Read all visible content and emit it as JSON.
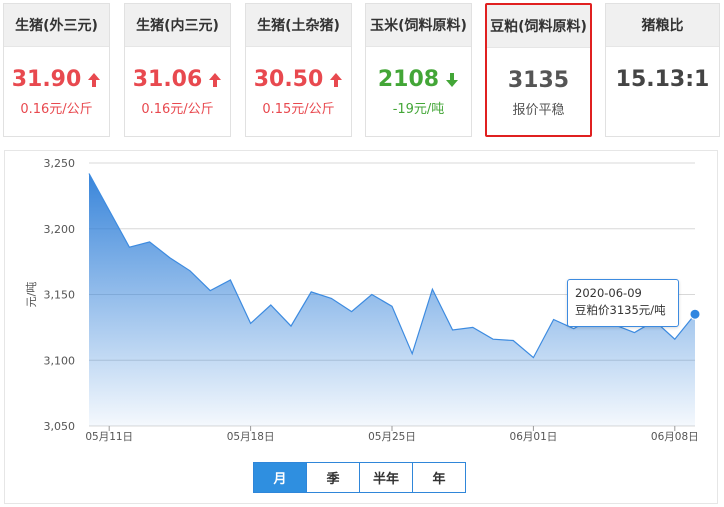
{
  "cards": [
    {
      "title": "生猪(外三元)",
      "price": "31.90",
      "change": "0.16元/公斤",
      "trend": "up"
    },
    {
      "title": "生猪(内三元)",
      "price": "31.06",
      "change": "0.16元/公斤",
      "trend": "up"
    },
    {
      "title": "生猪(土杂猪)",
      "price": "30.50",
      "change": "0.15元/公斤",
      "trend": "up"
    },
    {
      "title": "玉米(饲料原料)",
      "price": "2108",
      "change": "-19元/吨",
      "trend": "down"
    },
    {
      "title": "豆粕(饲料原料)",
      "price": "3135",
      "change": "报价平稳",
      "trend": "flat",
      "selected": true
    },
    {
      "title": "猪粮比",
      "price": "15.13:1",
      "change": "",
      "trend": "none"
    }
  ],
  "colors": {
    "up": "#e8494f",
    "down": "#43a637",
    "line": "#3d8be0",
    "selected_border": "#e02020"
  },
  "tooltip": {
    "date": "2020-06-09",
    "text": "豆粕价3135元/吨"
  },
  "range_buttons": [
    "月",
    "季",
    "半年",
    "年"
  ],
  "range_active": 0,
  "chart_data": {
    "type": "area",
    "ylabel": "元/吨",
    "ylim": [
      3050,
      3250
    ],
    "yticks": [
      3050,
      3100,
      3150,
      3200,
      3250
    ],
    "ytick_labels": [
      "3,050",
      "3,100",
      "3,150",
      "3,200",
      "3,250"
    ],
    "xtick_labels": [
      "05月11日",
      "05月18日",
      "05月25日",
      "06月01日",
      "06月08日"
    ],
    "xticks_at": [
      "2020-05-11",
      "2020-05-18",
      "2020-05-25",
      "2020-06-01",
      "2020-06-08"
    ],
    "x": [
      "2020-05-10",
      "2020-05-12",
      "2020-05-13",
      "2020-05-14",
      "2020-05-15",
      "2020-05-16",
      "2020-05-17",
      "2020-05-18",
      "2020-05-19",
      "2020-05-20",
      "2020-05-21",
      "2020-05-22",
      "2020-05-23",
      "2020-05-24",
      "2020-05-25",
      "2020-05-26",
      "2020-05-27",
      "2020-05-28",
      "2020-05-29",
      "2020-05-30",
      "2020-05-31",
      "2020-06-01",
      "2020-06-02",
      "2020-06-03",
      "2020-06-04",
      "2020-06-05",
      "2020-06-06",
      "2020-06-07",
      "2020-06-08",
      "2020-06-09"
    ],
    "values": [
      3242,
      3186,
      3190,
      3178,
      3168,
      3153,
      3161,
      3128,
      3142,
      3126,
      3152,
      3147,
      3137,
      3150,
      3141,
      3105,
      3154,
      3123,
      3125,
      3116,
      3115,
      3102,
      3131,
      3124,
      3133,
      3127,
      3121,
      3130,
      3116,
      3135
    ],
    "highlight": {
      "x": "2020-06-09",
      "value": 3135
    },
    "grid": true
  }
}
